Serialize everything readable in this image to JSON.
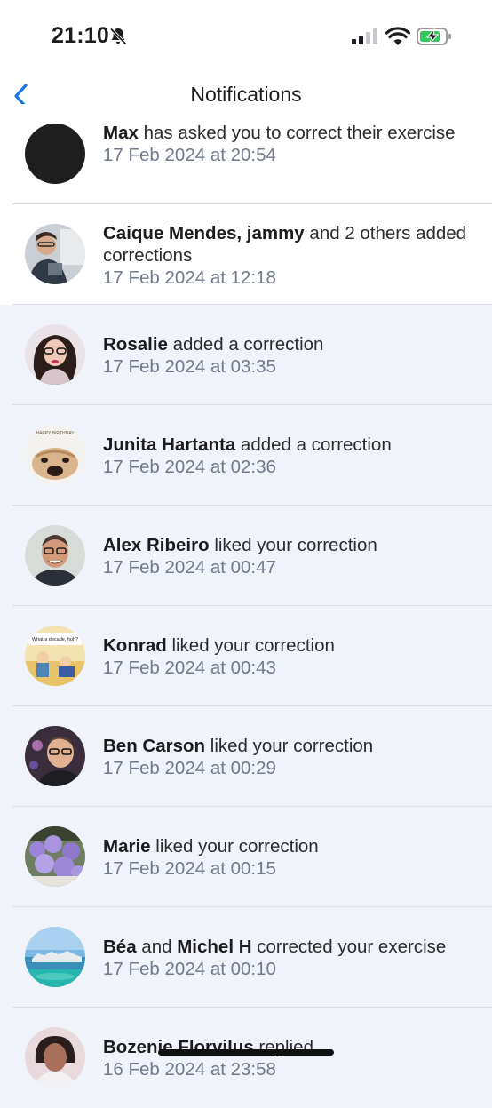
{
  "status": {
    "time": "21:10",
    "battery_color": "#35c759"
  },
  "nav": {
    "title": "Notifications",
    "back_icon": "chevron-left-icon",
    "accent": "#1a73e8"
  },
  "notifications": [
    {
      "name": "Max",
      "rest": " has asked you to correct their exercise",
      "time": "17 Feb 2024 at 20:54",
      "read": true
    },
    {
      "name": "Caique Mendes, jammy",
      "rest": " and 2 others added corrections",
      "time": "17 Feb 2024 at 12:18",
      "read": true
    },
    {
      "name": "Rosalie",
      "rest": "  added a correction",
      "time": "17 Feb 2024 at 03:35",
      "read": false
    },
    {
      "name": "Junita Hartanta",
      "rest": " added a correction",
      "time": "17 Feb 2024 at 02:36",
      "read": false
    },
    {
      "name": "Alex Ribeiro",
      "rest": " liked your correction",
      "time": "17 Feb 2024 at 00:47",
      "read": false
    },
    {
      "name": "Konrad",
      "rest": " liked your correction",
      "time": "17 Feb 2024 at 00:43",
      "read": false
    },
    {
      "name": "Ben Carson",
      "rest": " liked your correction",
      "time": "17 Feb 2024 at 00:29",
      "read": false
    },
    {
      "name": "Marie",
      "rest": " liked your correction",
      "time": "17 Feb 2024 at 00:15",
      "read": false
    },
    {
      "name": "Béa",
      "mid": "  and ",
      "name2": "Michel H",
      "rest": " corrected your exercise",
      "time": "17 Feb 2024 at 00:10",
      "read": false
    },
    {
      "name": "Bozenie Florvilus",
      "rest": " replied",
      "time": "16 Feb 2024 at 23:58",
      "read": false
    }
  ],
  "avatar_caption_konrad": "What a decade, huh?",
  "avatar_caption_junita": "HAPPY BIRTHDAY"
}
